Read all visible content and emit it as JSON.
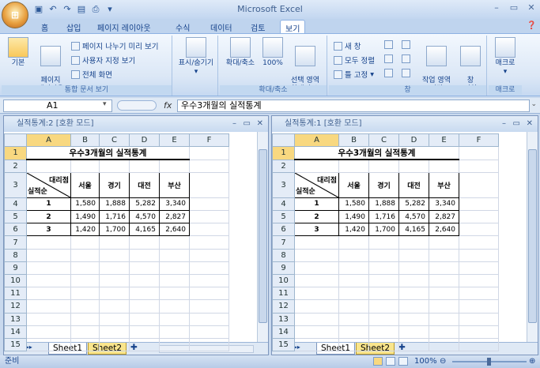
{
  "app": {
    "title": "Microsoft Excel"
  },
  "tabs": [
    "홈",
    "삽입",
    "페이지 레이아웃",
    "수식",
    "데이터",
    "검토",
    "보기"
  ],
  "active_tab": "보기",
  "ribbon": {
    "workbook_views": {
      "label": "통합 문서 보기",
      "normal": "기본",
      "page_layout": "페이지\n레이아웃",
      "page_break": "페이지 나누기 미리 보기",
      "custom_view": "사용자 지정 보기",
      "full_screen": "전체 화면"
    },
    "show_hide": {
      "label": "표시/숨기기"
    },
    "zoom": {
      "label": "확대/축소",
      "zoom": "확대/축소",
      "hundred": "100%",
      "selection": "선택 영역\n확대/축소"
    },
    "window": {
      "label": "창",
      "new_window": "새 창",
      "arrange_all": "모두 정렬",
      "freeze": "틀 고정",
      "save_workspace": "작업 영역\n저장",
      "switch": "창\n전환"
    },
    "macros": {
      "label": "매크로",
      "macro": "매크로"
    }
  },
  "formula_bar": {
    "name_box": "A1",
    "fx": "fx",
    "formula": "우수3개월의 실적통계"
  },
  "panes": [
    {
      "title": "실적통계:2  [호환 모드]",
      "sheet1": "Sheet1",
      "sheet2": "Sheet2"
    },
    {
      "title": "실적통계:1  [호환 모드]",
      "sheet1": "Sheet1",
      "sheet2": "Sheet2"
    }
  ],
  "sheet": {
    "columns": [
      "A",
      "B",
      "C",
      "D",
      "E",
      "F"
    ],
    "title": "우수3개월의 실적통계",
    "header_diag_top": "대리점",
    "header_diag_bottom": "실적순",
    "headers": [
      "서울",
      "경기",
      "대전",
      "부산"
    ],
    "rows": [
      {
        "rank": "1",
        "values": [
          "1,580",
          "1,888",
          "5,282",
          "3,340"
        ]
      },
      {
        "rank": "2",
        "values": [
          "1,490",
          "1,716",
          "4,570",
          "2,827"
        ]
      },
      {
        "rank": "3",
        "values": [
          "1,420",
          "1,700",
          "4,165",
          "2,640"
        ]
      }
    ]
  },
  "status": {
    "ready": "준비",
    "zoom": "100%"
  }
}
